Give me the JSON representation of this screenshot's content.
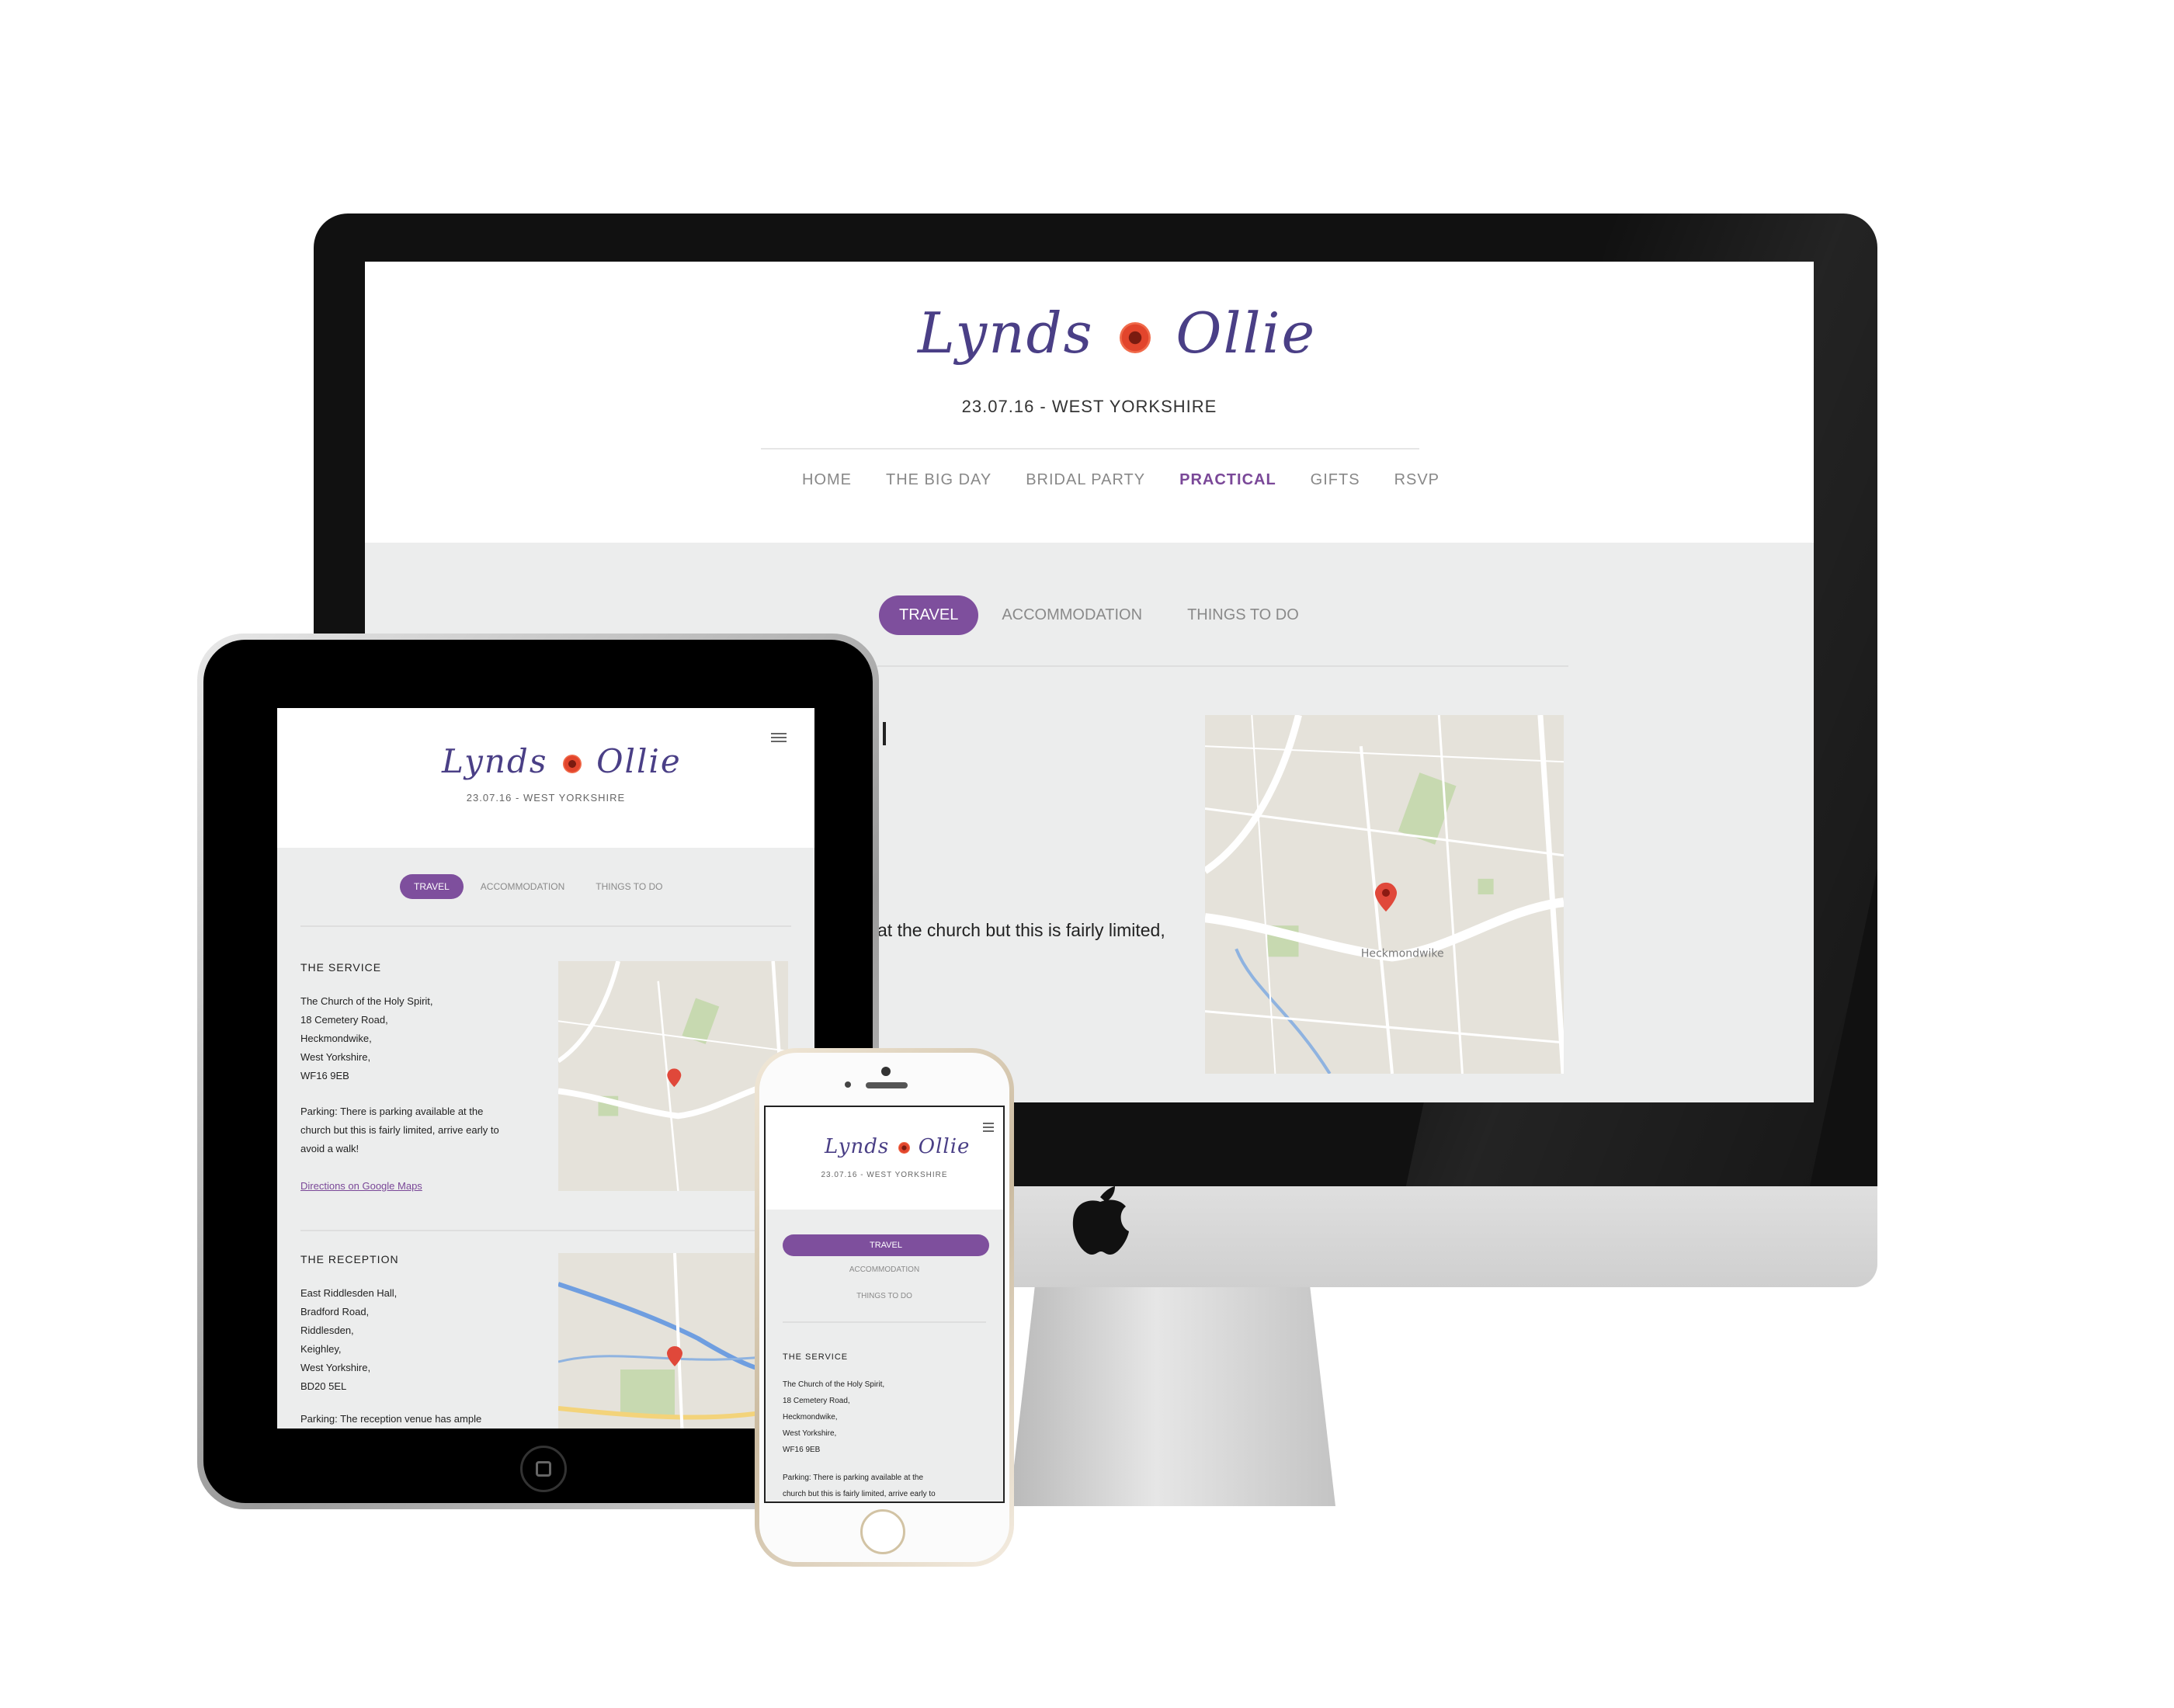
{
  "brand": {
    "name_left": "Lynds",
    "name_right": "Ollie",
    "date_location": "23.07.16 - WEST YORKSHIRE",
    "accent_color": "#7e4f9d",
    "logo_color": "#4a3f86"
  },
  "desktop": {
    "nav": {
      "items": [
        "HOME",
        "THE BIG DAY",
        "BRIDAL PARTY",
        "PRACTICAL",
        "GIFTS",
        "RSVP"
      ],
      "active": "PRACTICAL"
    },
    "tabs": {
      "active": "TRAVEL",
      "accommodation": "ACCOMMODATION",
      "things_to_do": "THINGS TO DO"
    },
    "partial_text": "at the church but this is fairly limited,"
  },
  "tablet": {
    "menu_icon": "hamburger-menu-icon",
    "tabs": {
      "active": "TRAVEL",
      "accommodation": "ACCOMMODATION",
      "things_to_do": "THINGS TO DO"
    },
    "service": {
      "title": "THE SERVICE",
      "address": [
        "The Church of the Holy Spirit,",
        "18 Cemetery Road,",
        "Heckmondwike,",
        "West Yorkshire,",
        "WF16 9EB"
      ],
      "parking": [
        "Parking: There is parking available at the",
        "church but this is fairly limited, arrive early to",
        "avoid a walk!"
      ],
      "directions_link": "Directions on Google Maps"
    },
    "reception": {
      "title": "THE RECEPTION",
      "address": [
        "East Riddlesden Hall,",
        "Bradford Road,",
        "Riddlesden,",
        "Keighley,",
        "West Yorkshire,",
        "BD20 5EL"
      ],
      "parking": "Parking: The reception venue has ample"
    }
  },
  "phone": {
    "tabs": {
      "active": "TRAVEL",
      "accommodation": "ACCOMMODATION",
      "things_to_do": "THINGS TO DO"
    },
    "service": {
      "title": "THE SERVICE",
      "address": [
        "The Church of the Holy Spirit,",
        "18 Cemetery Road,",
        "Heckmondwike,",
        "West Yorkshire,",
        "WF16 9EB"
      ],
      "parking": [
        "Parking: There is parking available at the",
        "church but this is fairly limited, arrive early to"
      ]
    }
  },
  "map": {
    "town_label": "Heckmondwike",
    "marker_icon": "map-pin-icon"
  }
}
